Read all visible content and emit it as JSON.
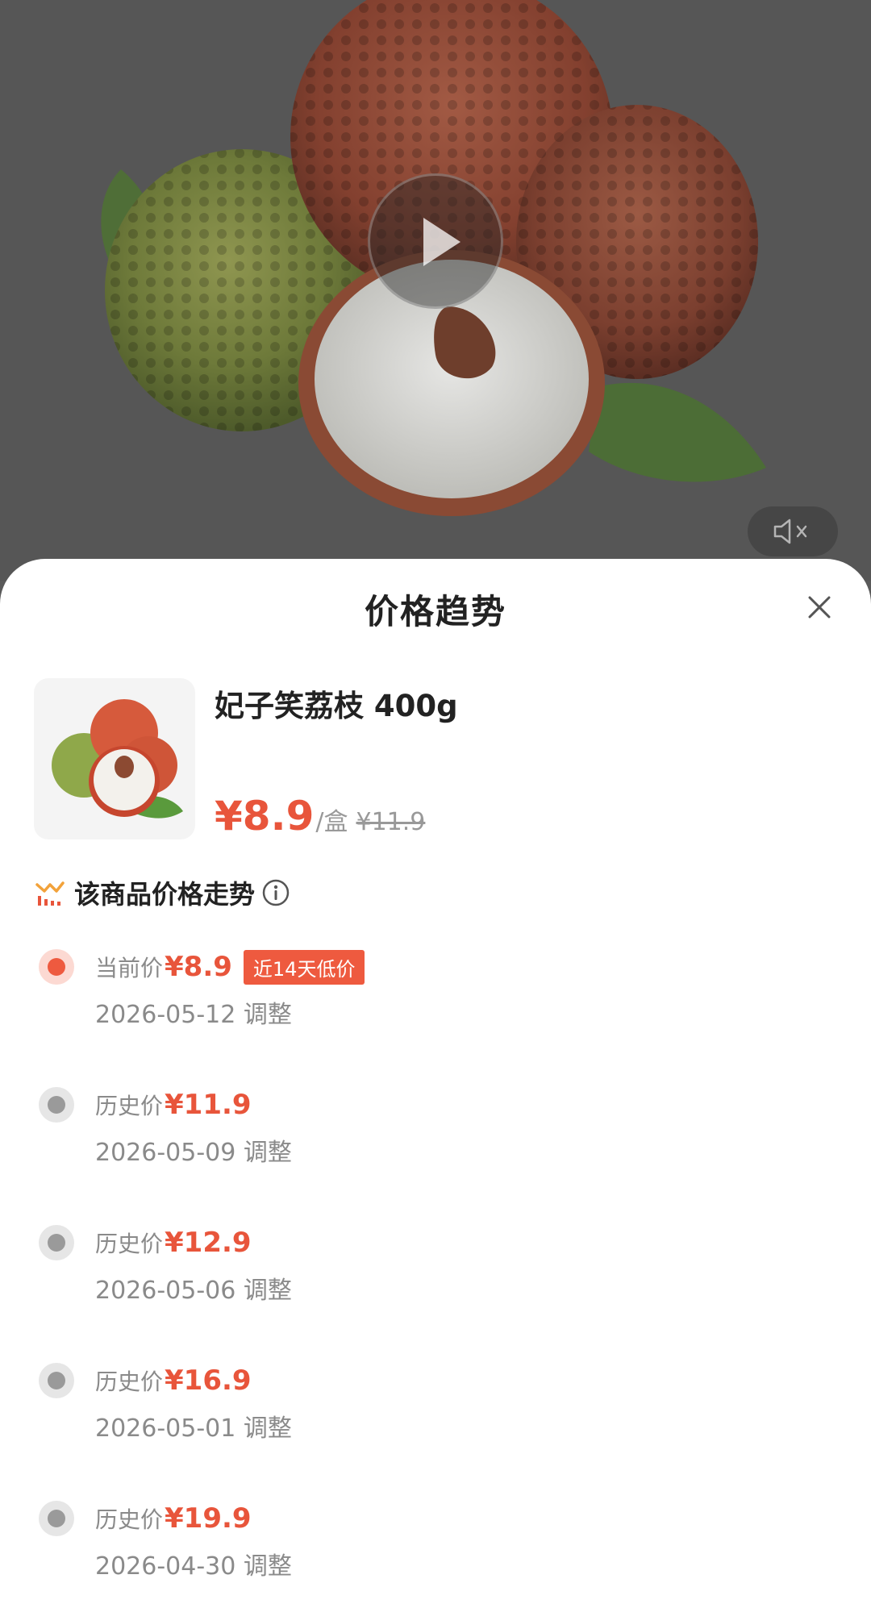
{
  "video": {
    "play_icon": "play-icon",
    "mute_icon": "speaker-muted-icon"
  },
  "sheet": {
    "title": "价格趋势",
    "close_icon": "close-icon"
  },
  "product": {
    "name": "妃子笑荔枝 400g",
    "price": "¥8.9",
    "unit": "/盒",
    "original_price": "¥11.9"
  },
  "trend": {
    "heading": "该商品价格走势",
    "heading_icon": "price-trend-icon",
    "info_icon": "info-icon",
    "entries": [
      {
        "label": "当前价",
        "price": "¥8.9",
        "badge": "近14天低价",
        "date": "2026-05-12 调整"
      },
      {
        "label": "历史价",
        "price": "¥11.9",
        "date": "2026-05-09 调整"
      },
      {
        "label": "历史价",
        "price": "¥12.9",
        "date": "2026-05-06 调整"
      },
      {
        "label": "历史价",
        "price": "¥16.9",
        "date": "2026-05-01 调整"
      },
      {
        "label": "历史价",
        "price": "¥19.9",
        "date": "2026-04-30 调整"
      }
    ]
  },
  "colors": {
    "accent": "#e8553b",
    "badge_bg": "#ee5a3f",
    "muted_text": "#8a8a8a"
  }
}
